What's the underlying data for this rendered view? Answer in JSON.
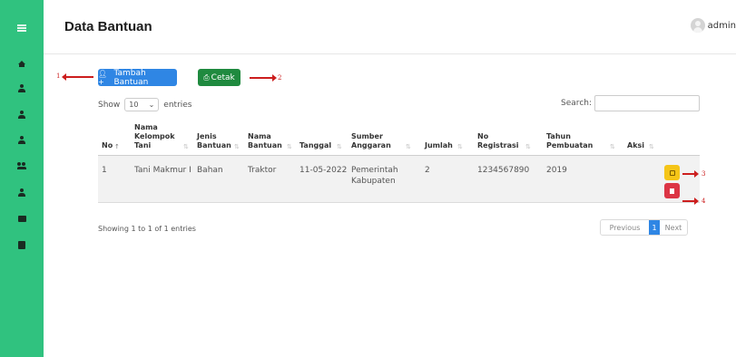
{
  "header": {
    "title": "Data Bantuan",
    "user": "admin"
  },
  "sidebar": {
    "icons": [
      "menu-icon",
      "home-icon",
      "user-icon",
      "user-icon",
      "user-icon",
      "users-icon",
      "user-icon",
      "folder-icon",
      "book-icon"
    ]
  },
  "toolbar": {
    "add_label": "Tambah Bantuan",
    "print_label": "Cetak"
  },
  "annotations": [
    "1",
    "2",
    "3",
    "4"
  ],
  "table": {
    "show_label": "Show",
    "entries_label": "entries",
    "page_length": "10",
    "search_label": "Search:",
    "search_value": "",
    "columns": [
      "No",
      "Nama Kelompok Tani",
      "Jenis Bantuan",
      "Nama Bantuan",
      "Tanggal",
      "Sumber Anggaran",
      "Jumlah",
      "No Registrasi",
      "Tahun Pembuatan",
      "Aksi"
    ],
    "rows": [
      {
        "no": "1",
        "kelompok": "Tani Makmur I",
        "jenis": "Bahan",
        "nama": "Traktor",
        "tanggal": "11-05-2022",
        "sumber": "Pemerintah Kabupaten",
        "jumlah": "2",
        "registrasi": "1234567890",
        "tahun": "2019"
      }
    ],
    "info": "Showing 1 to 1 of 1 entries"
  },
  "pagination": {
    "previous": "Previous",
    "current": "1",
    "next": "Next"
  },
  "colors": {
    "sidebar": "#30c27f",
    "primary": "#2f86e4",
    "success": "#1f8a3f",
    "warning": "#f5c518",
    "danger": "#dc3545",
    "annotation": "#cc1e1e"
  }
}
